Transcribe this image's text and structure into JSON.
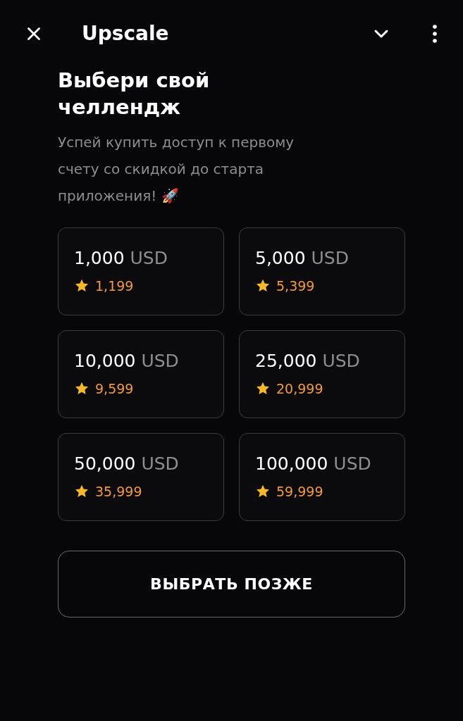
{
  "header": {
    "title": "Upscale"
  },
  "heading": "Выбери свой челлендж",
  "subtitle": "Успей купить доступ к первому счету со скидкой до старта приложения! 🚀",
  "plans": [
    {
      "amount": "1,000",
      "currency": "USD",
      "price": "1,199"
    },
    {
      "amount": "5,000",
      "currency": "USD",
      "price": "5,399"
    },
    {
      "amount": "10,000",
      "currency": "USD",
      "price": "9,599"
    },
    {
      "amount": "25,000",
      "currency": "USD",
      "price": "20,999"
    },
    {
      "amount": "50,000",
      "currency": "USD",
      "price": "35,999"
    },
    {
      "amount": "100,000",
      "currency": "USD",
      "price": "59,999"
    }
  ],
  "later_button": "ВЫБРАТЬ ПОЗЖЕ"
}
